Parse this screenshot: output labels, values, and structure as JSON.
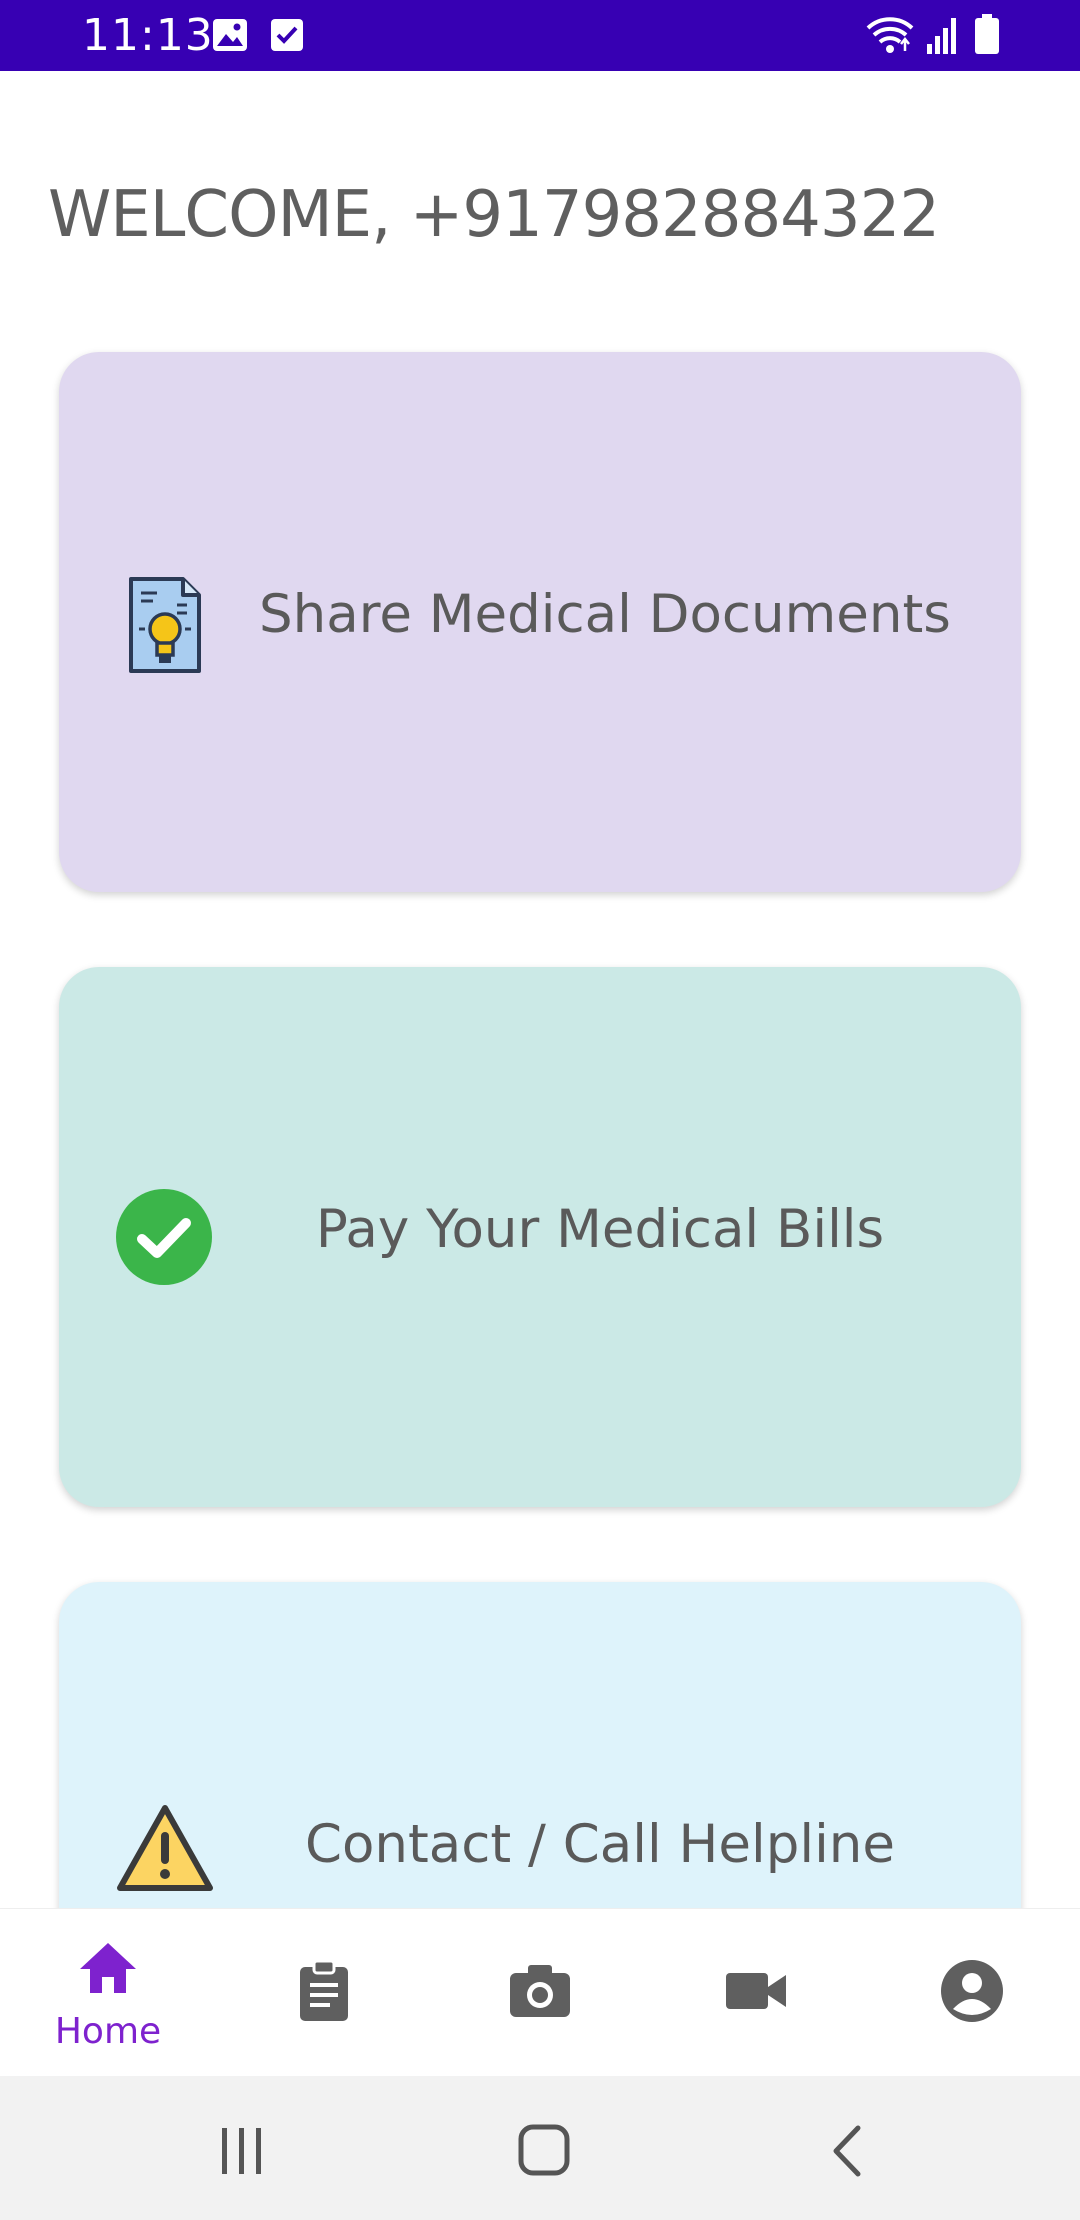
{
  "status_bar": {
    "time": "11:13",
    "background": "#3700b3",
    "icons": [
      "image-icon",
      "check-square-icon",
      "wifi-icon",
      "signal-icon",
      "battery-icon"
    ]
  },
  "welcome": {
    "text": "WELCOME, +917982884322"
  },
  "cards": [
    {
      "label": "Share Medical Documents",
      "icon": "document-lightbulb-icon",
      "color": "#e0d8f0"
    },
    {
      "label": "Pay Your Medical Bills",
      "icon": "check-circle-icon",
      "color": "#cbe9e6"
    },
    {
      "label": "Contact / Call Helpline",
      "icon": "warning-icon",
      "color": "#def3fb"
    }
  ],
  "bottom_nav": {
    "accent": "#7e22ce",
    "items": [
      {
        "label": "Home",
        "icon": "home-icon",
        "active": true
      },
      {
        "label": "",
        "icon": "clipboard-icon",
        "active": false
      },
      {
        "label": "",
        "icon": "camera-icon",
        "active": false
      },
      {
        "label": "",
        "icon": "video-camera-icon",
        "active": false
      },
      {
        "label": "",
        "icon": "account-circle-icon",
        "active": false
      }
    ]
  },
  "system_nav": {
    "icons": [
      "recents-icon",
      "home-button-icon",
      "back-icon"
    ]
  }
}
